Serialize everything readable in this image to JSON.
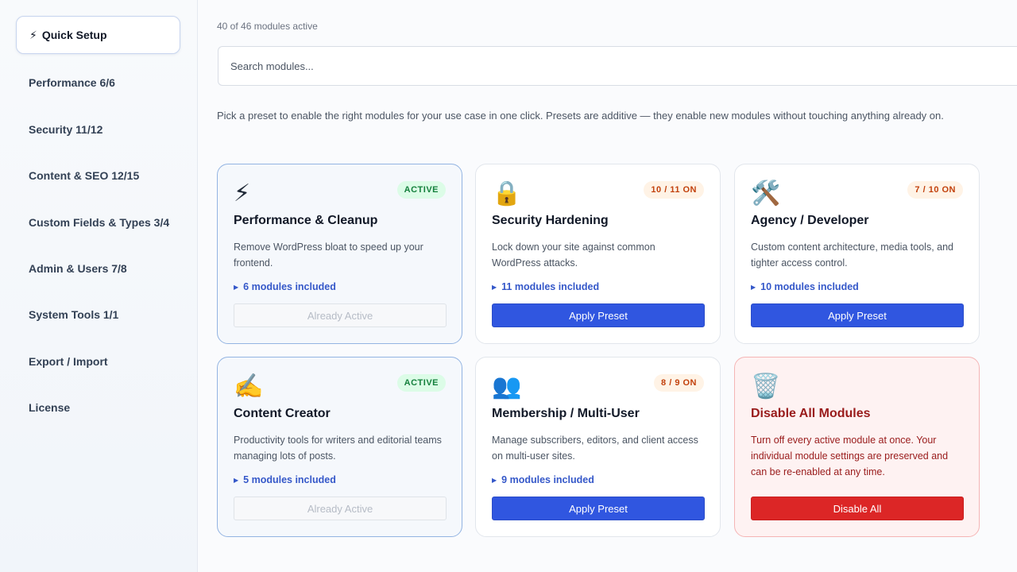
{
  "sidebar": {
    "items": [
      {
        "icon": "⚡",
        "label": "Quick Setup"
      },
      {
        "label": "Performance 6/6"
      },
      {
        "label": "Security 11/12"
      },
      {
        "label": "Content & SEO 12/15"
      },
      {
        "label": "Custom Fields & Types 3/4"
      },
      {
        "label": "Admin & Users 7/8"
      },
      {
        "label": "System Tools 1/1"
      },
      {
        "label": "Export / Import"
      },
      {
        "label": "License"
      }
    ]
  },
  "main": {
    "count_text": "40 of 46 modules active",
    "search": {
      "placeholder": "Search modules..."
    },
    "intro": "Pick a preset to enable the right modules for your use case in one click. Presets are additive — they enable new modules without touching anything already on.",
    "cards": [
      {
        "emoji": "⚡",
        "icon_name": "lightning-icon",
        "badge": "ACTIVE",
        "title": "Performance & Cleanup",
        "desc": "Remove WordPress bloat to speed up your frontend.",
        "modules": "6 modules included",
        "button": "Already Active"
      },
      {
        "emoji": "🔒",
        "icon_name": "lock-icon",
        "badge": "10 / 11 ON",
        "title": "Security Hardening",
        "desc": "Lock down your site against common WordPress attacks.",
        "modules": "11 modules included",
        "button": "Apply Preset"
      },
      {
        "emoji": "🛠️",
        "icon_name": "tools-icon",
        "badge": "7 / 10 ON",
        "title": "Agency / Developer",
        "desc": "Custom content architecture, media tools, and tighter access control.",
        "modules": "10 modules included",
        "button": "Apply Preset"
      },
      {
        "emoji": "✍️",
        "icon_name": "writing-hand-icon",
        "badge": "ACTIVE",
        "title": "Content Creator",
        "desc": "Productivity tools for writers and editorial teams managing lots of posts.",
        "modules": "5 modules included",
        "button": "Already Active"
      },
      {
        "emoji": "👥",
        "icon_name": "users-icon",
        "badge": "8 / 9 ON",
        "title": "Membership / Multi-User",
        "desc": "Manage subscribers, editors, and client access on multi-user sites.",
        "modules": "9 modules included",
        "button": "Apply Preset"
      },
      {
        "emoji": "🗑️",
        "icon_name": "trash-icon",
        "title": "Disable All Modules",
        "desc": "Turn off every active module at once. Your individual module settings are preserved and can be re-enabled at any time.",
        "button": "Disable All"
      }
    ]
  },
  "colors": {
    "accent": "#3056e0",
    "danger": "#dc2626",
    "active_badge": "#15803d",
    "partial_badge": "#c2410c"
  }
}
